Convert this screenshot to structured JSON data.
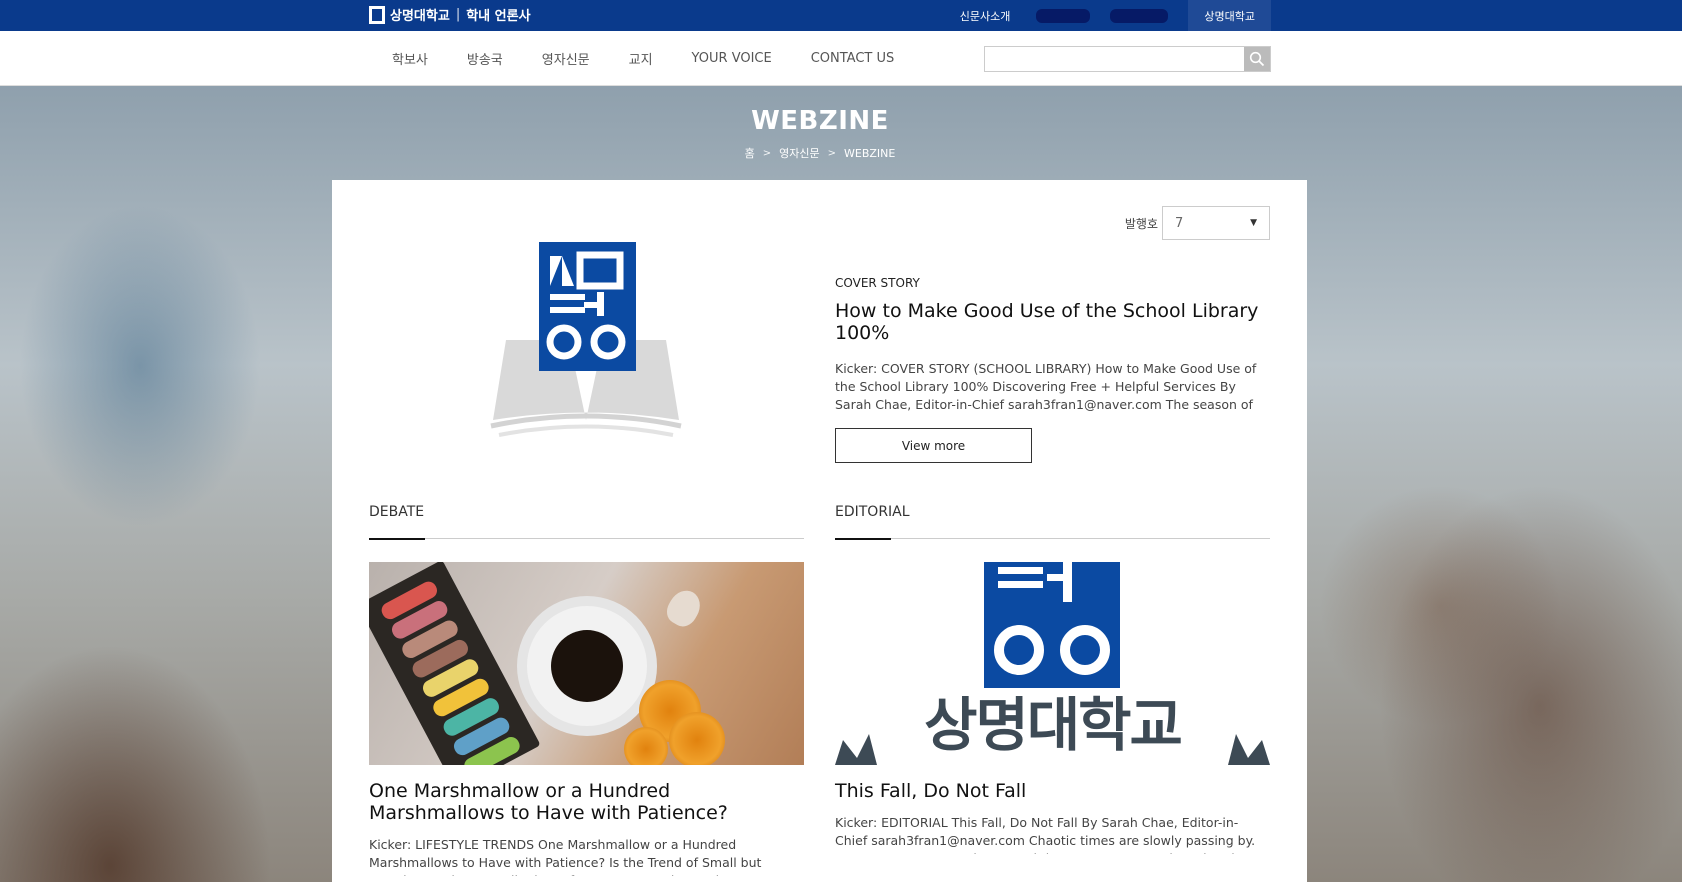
{
  "topbar": {
    "brand_main": "상명대학교",
    "brand_sep": "|",
    "brand_sub": "학내 언론사",
    "links": [
      "신문사소개"
    ],
    "active_link": "상명대학교"
  },
  "nav": {
    "items": [
      "학보사",
      "방송국",
      "영자신문",
      "교지",
      "YOUR VOICE",
      "CONTACT US"
    ],
    "search_placeholder": ""
  },
  "hero": {
    "title": "WEBZINE",
    "breadcrumb": [
      "홈",
      "영자신문",
      "WEBZINE"
    ]
  },
  "issue": {
    "label": "발행호",
    "value": "7"
  },
  "cover": {
    "kicker": "COVER STORY",
    "title": "How to Make Good Use of the School Library 100%",
    "excerpt": "Kicker: COVER STORY (SCHOOL LIBRARY) How to Make Good Use of the School Library 100% Discovering Free + Helpful Services By Sarah Chae, Editor-in-Chief sarah3fran1@naver.com The season of reading, Autumn,",
    "button": "View more"
  },
  "debate": {
    "section": "DEBATE",
    "title": "One Marshmallow or a Hundred Marshmallows to Have with Patience?",
    "excerpt": "Kicker: LIFESTYLE TRENDS One Marshmallow or a Hundred Marshmallows to Have with Patience? Is the Trend of Small but Certain Happiness Really the Refuge We Created? By Min-gyeong Lee, Editor lee.mkgeoh.gmail.com"
  },
  "editorial": {
    "section": "EDITORIAL",
    "title": "This Fall, Do Not Fall",
    "excerpt": "Kicker: EDITORIAL This Fall, Do Not Fall By Sarah Chae, Editor-in-Chief sarah3fran1@naver.com Chaotic times are slowly passing by. Post-corona seems to be around the corner. Summer has already come to an end. How",
    "logo_text": "상명대학교"
  },
  "colors": {
    "brand_blue": "#0a3a8c",
    "logo_blue": "#0b4aa2"
  }
}
